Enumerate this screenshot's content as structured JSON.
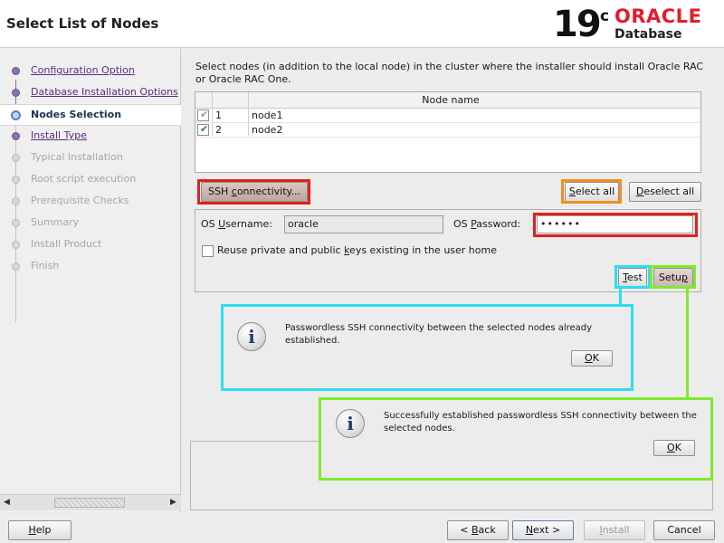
{
  "header": {
    "title": "Select List of Nodes",
    "logo": {
      "version": "19",
      "version_sup": "c",
      "brand": "ORACLE",
      "product": "Database"
    }
  },
  "nav": {
    "steps": [
      {
        "label": "Configuration Option",
        "state": "done"
      },
      {
        "label": "Database Installation Options",
        "state": "done"
      },
      {
        "label": "Nodes Selection",
        "state": "current"
      },
      {
        "label": "Install Type",
        "state": "done"
      },
      {
        "label": "Typical Installation",
        "state": "disabled"
      },
      {
        "label": "Root script execution",
        "state": "disabled"
      },
      {
        "label": "Prerequisite Checks",
        "state": "disabled"
      },
      {
        "label": "Summary",
        "state": "disabled"
      },
      {
        "label": "Install Product",
        "state": "disabled"
      },
      {
        "label": "Finish",
        "state": "disabled"
      }
    ]
  },
  "main": {
    "instructions": "Select nodes (in addition to the local node) in the cluster where the installer should install Oracle RAC or Oracle RAC One.",
    "table": {
      "column_header": "Node name",
      "rows": [
        {
          "num": "1",
          "name": "node1",
          "checked": true,
          "enabled": false
        },
        {
          "num": "2",
          "name": "node2",
          "checked": true,
          "enabled": true
        }
      ]
    },
    "ssh_button": {
      "pre": "SSH ",
      "accel": "c",
      "post": "onnectivity..."
    },
    "select_all": {
      "accel": "S",
      "post": "elect all"
    },
    "deselect_all": {
      "accel": "D",
      "post": "eselect all"
    },
    "ssh": {
      "username_label_pre": "OS ",
      "username_label_accel": "U",
      "username_label_post": "sername:",
      "username_value": "oracle",
      "password_label_pre": "OS ",
      "password_label_accel": "P",
      "password_label_post": "assword:",
      "password_value": "••••••",
      "reuse_pre": "Reuse private and public ",
      "reuse_accel": "k",
      "reuse_post": "eys existing in the user home",
      "reuse_checked": false,
      "test": {
        "accel": "T",
        "post": "est"
      },
      "setup": {
        "pre": "Setu",
        "accel": "p",
        "post": ""
      }
    }
  },
  "dialogs": {
    "test_result": {
      "message": "Passwordless SSH connectivity between the selected nodes already established.",
      "ok": {
        "accel": "O",
        "post": "K"
      }
    },
    "setup_result": {
      "message": "Successfully established passwordless SSH connectivity between the selected nodes.",
      "ok": {
        "accel": "O",
        "post": "K"
      }
    }
  },
  "footer": {
    "help": {
      "accel": "H",
      "post": "elp"
    },
    "back": {
      "pre": "< ",
      "accel": "B",
      "post": "ack"
    },
    "next": {
      "accel": "N",
      "post": "ext >"
    },
    "install": {
      "accel": "I",
      "post": "nstall"
    },
    "cancel": "Cancel"
  },
  "colors": {
    "highlight_red": "#E0201C",
    "highlight_orange": "#F28D1E",
    "highlight_cyan": "#2FDDF0",
    "highlight_green": "#7DEB2C",
    "oracle_red": "#E51C2A",
    "nav_done": "#5B2B84"
  },
  "icons": [
    "step-done-icon",
    "step-current-icon",
    "step-pending-icon",
    "info-icon",
    "checkbox-checked-icon"
  ]
}
